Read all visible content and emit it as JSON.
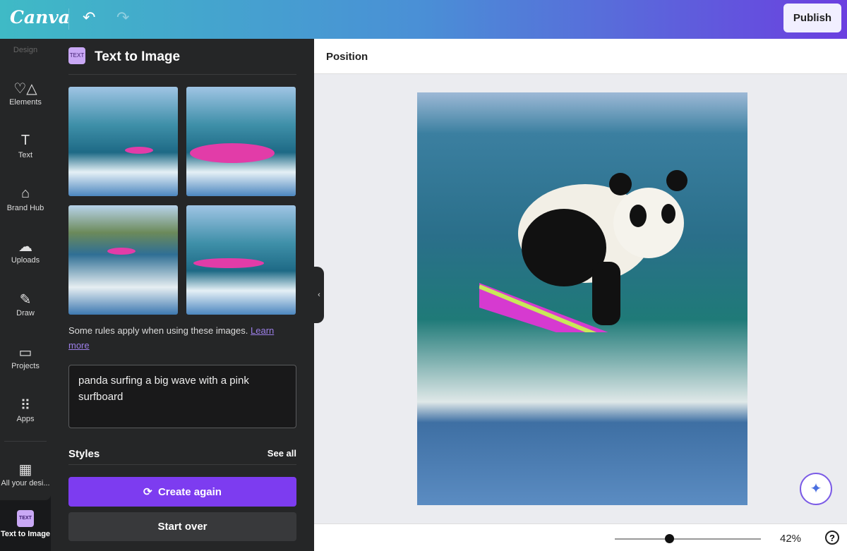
{
  "header": {
    "logo": "Canva",
    "undo_icon": "↶",
    "redo_icon": "↷",
    "publish": "Publish"
  },
  "rail": {
    "items": [
      {
        "label": "Design",
        "icon": ""
      },
      {
        "label": "Elements",
        "icon": "♡△"
      },
      {
        "label": "Text",
        "icon": "T"
      },
      {
        "label": "Brand Hub",
        "icon": "⌂"
      },
      {
        "label": "Uploads",
        "icon": "☁"
      },
      {
        "label": "Draw",
        "icon": "✎"
      },
      {
        "label": "Projects",
        "icon": "▭"
      },
      {
        "label": "Apps",
        "icon": "⠿"
      },
      {
        "label": "All your desi...",
        "icon": "▦"
      },
      {
        "label": "Text to Image",
        "icon": "TEXT"
      }
    ]
  },
  "panel": {
    "title": "Text to Image",
    "rules_text": "Some rules apply when using these images.",
    "learn_more": "Learn more",
    "prompt": "panda surfing a big wave with a pink surfboard",
    "styles": "Styles",
    "see_all": "See all",
    "create_again": "Create again",
    "start_over": "Start over"
  },
  "toolbar": {
    "position": "Position"
  },
  "footer": {
    "zoom": "42%",
    "zoom_fraction": 0.42,
    "help": "?"
  },
  "colors": {
    "accent": "#7d3cf0",
    "panel": "#252627"
  }
}
